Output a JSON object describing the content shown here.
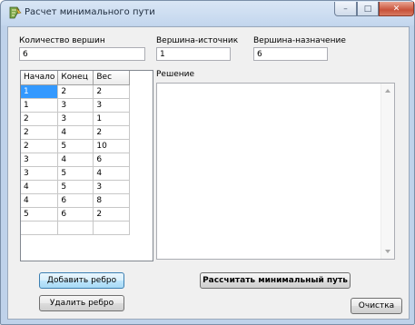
{
  "window": {
    "title": "Расчет минимального пути",
    "min_glyph": "–",
    "max_glyph": "□",
    "close_glyph": "✕"
  },
  "fields": {
    "vertex_count": {
      "label": "Количество вершин",
      "value": "6"
    },
    "source": {
      "label": "Вершина-источник",
      "value": "1"
    },
    "target": {
      "label": "Вершина-назначение",
      "value": "6"
    }
  },
  "edges_table": {
    "columns": [
      "Начало",
      "Конец",
      "Вес"
    ],
    "rows": [
      [
        "1",
        "2",
        "2"
      ],
      [
        "1",
        "3",
        "3"
      ],
      [
        "2",
        "3",
        "1"
      ],
      [
        "2",
        "4",
        "2"
      ],
      [
        "2",
        "5",
        "10"
      ],
      [
        "3",
        "4",
        "6"
      ],
      [
        "3",
        "5",
        "4"
      ],
      [
        "4",
        "5",
        "3"
      ],
      [
        "4",
        "6",
        "8"
      ],
      [
        "5",
        "6",
        "2"
      ]
    ]
  },
  "solution": {
    "label": "Решение",
    "text": ""
  },
  "buttons": {
    "add_edge": "Добавить ребро",
    "remove_edge": "Удалить ребро",
    "calculate": "Рассчитать минимальный путь",
    "clear": "Очистка"
  },
  "colors": {
    "selection": "#3399ff",
    "close_button": "#c8523a"
  }
}
